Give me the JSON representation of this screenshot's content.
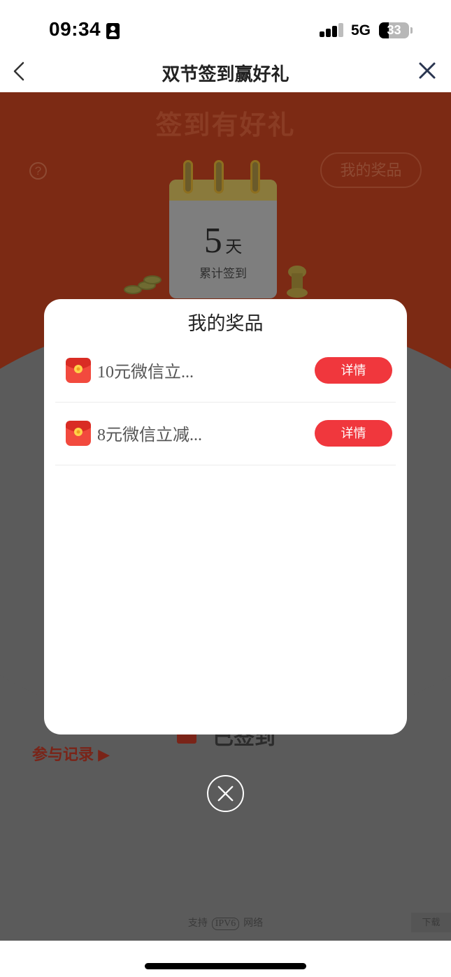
{
  "status_bar": {
    "time": "09:34",
    "network": "5G",
    "battery": "33",
    "battery_level": 0.33
  },
  "nav": {
    "title": "双节签到赢好礼"
  },
  "background": {
    "banner_title": "签到有好礼",
    "help_icon": "?",
    "my_prizes_button": "我的奖品",
    "calendar": {
      "days_number": "5",
      "days_unit": "天",
      "caption": "累计签到"
    },
    "participation_link": "参与记录 ▶",
    "signed_label": "已签到",
    "footer": {
      "prefix": "支持",
      "ipv6": "IPV6",
      "suffix": "网络",
      "tag": "下载"
    }
  },
  "modal": {
    "title": "我的奖品",
    "prizes": [
      {
        "name": "10元微信立...",
        "detail_label": "详情",
        "icon": "red-envelope-icon"
      },
      {
        "name": "8元微信立减...",
        "detail_label": "详情",
        "icon": "red-envelope-icon"
      }
    ]
  },
  "colors": {
    "accent": "#f0373d",
    "overlay": "#5b5b5b",
    "banner_dim": "#7c2a14"
  }
}
